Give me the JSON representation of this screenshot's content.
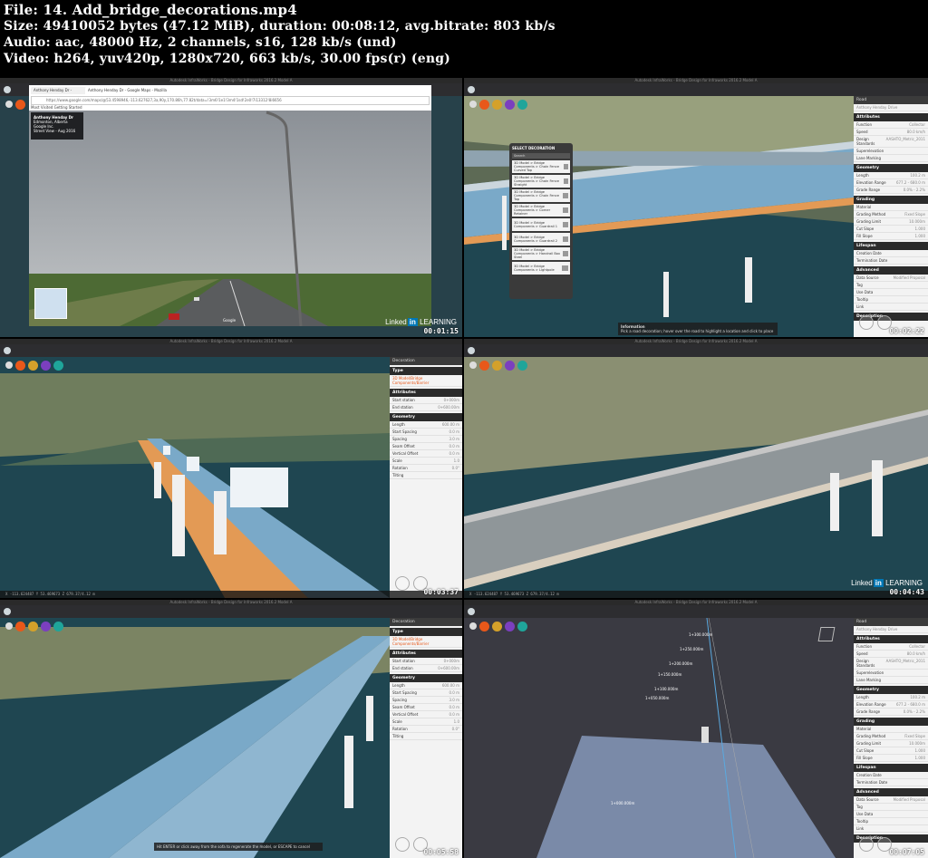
{
  "file_info": {
    "file": "File: 14. Add_bridge_decorations.mp4",
    "size": "Size: 49410052 bytes (47.12 MiB), duration: 00:08:12, avg.bitrate: 803 kb/s",
    "audio": "Audio: aac, 48000 Hz, 2 channels, s16, 128 kb/s (und)",
    "video": "Video: h264, yuv420p, 1280x720, 663 kb/s, 30.00 fps(r) (eng)"
  },
  "app": {
    "window_title": "Autodesk InfraWorks - Bridge Design for Infraworks 2016.2 Model A",
    "toolbar_label": "Engineering View",
    "model_label": "BridgeDesignS",
    "linkedin_text": "Linked",
    "linkedin_badge": "in",
    "learning": "LEARNING"
  },
  "timestamps": [
    "00:01:15",
    "00:02:22",
    "00:03:37",
    "00:04:43",
    "00:05:58",
    "00:07:05"
  ],
  "colors": {
    "btn_orange": "#e8581a",
    "btn_yellow": "#d4a12a",
    "btn_purple": "#7b3fbf",
    "btn_teal": "#1fa59a",
    "water": "#1f4651",
    "road": "#7aa9c8",
    "deck_orange": "#e39a55"
  },
  "frame1": {
    "tabs": [
      "Anthony Henday Dr - Google Maps",
      "Anthony Henday Dr - Google Maps - Mozilla Firefox"
    ],
    "url": "https://www.google.com/maps/@53.4598946,-113.627627,3a,90y,170.86h,77.82t/data=!3m6!1e1!3m4!1sd!2e0!7i13312!8i6656",
    "bookmarks": "Most Visited   Getting Started",
    "card_title": "Anthony Henday Dr",
    "card_sub": "Edmonton, Alberta",
    "card_link": "Google Inc.",
    "card_date": "Street View - Aug 2016",
    "google": "Google"
  },
  "frame2": {
    "dialog_title": "SELECT DECORATION",
    "search": "Search",
    "items": [
      "3D Model > Bridge Components > Chain Fence Curved Top",
      "3D Model > Bridge Components > Chain Fence Straight",
      "3D Model > Bridge Components > Chain Fence Top",
      "3D Model > Bridge Components > Corner Retainer",
      "3D Model > Bridge Components > Guardrail 1",
      "3D Model > Bridge Components > Guardrail 2",
      "3D Model > Bridge Components > Handrail Box Steel",
      "3D Model > Bridge Components > Lightpole"
    ],
    "tip_title": "Information",
    "tip_text": "Pick a road decoration; hover over the road to highlight a location and click to place"
  },
  "road_panel": {
    "type": "Road",
    "name": "Anthony Henday Drive",
    "sections": [
      {
        "title": "Attributes",
        "rows": [
          [
            "Function",
            "Collector"
          ],
          [
            "Speed",
            "80.0 km/h"
          ],
          [
            "Design Standards",
            "AASHTO_Metric_2011"
          ],
          [
            "Superelevation",
            ""
          ],
          [
            "Lane Marking",
            ""
          ]
        ]
      },
      {
        "title": "Geometry",
        "rows": [
          [
            "Length",
            "100.2 m"
          ],
          [
            "Elevation Range",
            "677.2 - 680.0 m"
          ],
          [
            "Grade Range",
            "0.0% - 2.2%"
          ]
        ]
      },
      {
        "title": "Grading",
        "rows": [
          [
            "Material",
            ""
          ],
          [
            "Grading Method",
            "Fixed Slope"
          ],
          [
            "Grading Limit",
            "10.000m"
          ],
          [
            "Cut Slope",
            "1.000"
          ],
          [
            "Fill Slope",
            "1.000"
          ]
        ]
      },
      {
        "title": "Lifespan",
        "rows": [
          [
            "Creation Date",
            ""
          ],
          [
            "Termination Date",
            ""
          ]
        ]
      },
      {
        "title": "Advanced",
        "rows": [
          [
            "Data Source",
            "Modified Proposal"
          ],
          [
            "Tag",
            ""
          ],
          [
            "Use Data",
            ""
          ],
          [
            "Tooltip",
            ""
          ],
          [
            "Link",
            ""
          ]
        ]
      },
      {
        "title": "Description",
        "rows": []
      }
    ]
  },
  "decoration_panel": {
    "title": "Decoration",
    "type_header": "Type",
    "type_value": "3D Model/Bridge Components/Barrier",
    "sections": [
      {
        "title": "Attributes",
        "rows": [
          [
            "Start station",
            "0+000m"
          ],
          [
            "End station",
            "0+600.00m"
          ]
        ]
      },
      {
        "title": "Geometry",
        "rows": [
          [
            "Length",
            "600.00 m"
          ],
          [
            "Start Spacing",
            "0.0 m"
          ],
          [
            "Spacing",
            "3.0 m"
          ],
          [
            "Seam Offset",
            "0.0 m"
          ],
          [
            "Vertical Offset",
            "0.0 m"
          ],
          [
            "Scale",
            "1.0"
          ],
          [
            "Rotation",
            "0.0°"
          ],
          [
            "Tilting",
            ""
          ]
        ]
      }
    ]
  },
  "frame5": {
    "hint": "Hit ENTER or click away from the sofa to regenerate the model, or ESCAPE to cancel"
  },
  "frame6": {
    "labels": [
      "1+300.000m",
      "1+250.000m",
      "1+200.000m",
      "1+150.000m",
      "1+100.000m",
      "1+050.000m",
      "1+000.000m"
    ]
  },
  "status_coords": "X -113.624487   Y 53.469673   Z 679.37/4.12 m"
}
